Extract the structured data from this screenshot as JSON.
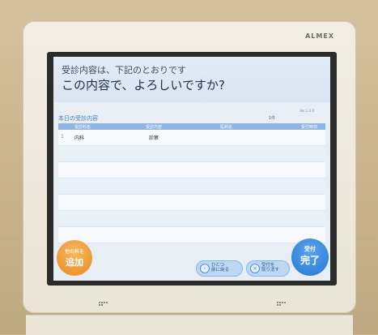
{
  "device": {
    "brand": "ALMEX"
  },
  "header": {
    "subtitle": "受診内容は、下記のとおりです",
    "question": "この内容で、よろしいですか?"
  },
  "section": {
    "title": "本日の受診内容",
    "count": "1件",
    "version": "Ver.1.0.0"
  },
  "table": {
    "columns": [
      "受診科名",
      "受診内容",
      "医師名",
      "受付時刻"
    ],
    "rows": [
      {
        "no": "1",
        "dept": "内科",
        "content": "診察",
        "doctor": "",
        "time": ""
      }
    ]
  },
  "buttons": {
    "add_small": "他の科を",
    "add_big": "追加",
    "back_line1": "ひとつ",
    "back_line2": "前に戻る",
    "cancel_line1": "受付を",
    "cancel_line2": "取り消す",
    "done_small": "受付",
    "done_big": "完了"
  },
  "colors": {
    "accent_blue": "#2477cf",
    "add_orange": "#e88a25",
    "header_bg": "#dbe6f4"
  }
}
